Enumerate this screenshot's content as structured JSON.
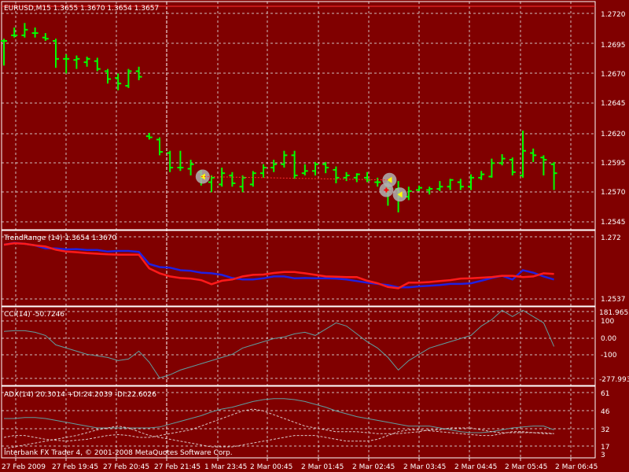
{
  "colors": {
    "background": "#800000",
    "grid": "#e0e0e0",
    "bar": "#00ff00",
    "trend_blue": "#2020e0",
    "trend_red": "#ff1a1a",
    "cci_line": "#5f9ea0",
    "adx_line": "#5f9ea0",
    "di_line": "#d8c8c8",
    "text": "#ffffff"
  },
  "main": {
    "title": "EURUSD,M15  1.3655 1.3670 1.3654 1.3657",
    "ticks": [
      "1.2720",
      "1.2695",
      "1.2670",
      "1.2645",
      "1.2620",
      "1.2595",
      "1.2570",
      "1.2545"
    ]
  },
  "trend": {
    "title": "TrendRange (14)  1.3654 1.3670",
    "ticks": [
      "1.272",
      "1.2537"
    ]
  },
  "cci": {
    "title": "CCI(14) -50.7246",
    "ticks": [
      "181.9652",
      "100",
      "0.00",
      "-100",
      "-277.993"
    ]
  },
  "adx": {
    "title": "ADX(14) 20.3014 +DI:24.2039 -DI:22.6026",
    "ticks": [
      "61",
      "46",
      "32",
      "17",
      "3"
    ]
  },
  "footer": {
    "copyright": "Interbank FX Trader 4, © 2001-2008 MetaQuotes Software Corp."
  },
  "time_axis": [
    "27 Feb 2009",
    "27 Feb 19:45",
    "27 Feb 20:45",
    "27 Feb 21:45",
    "1 Mar 23:45",
    "2 Mar 00:45",
    "2 Mar 01:45",
    "2 Mar 02:45",
    "2 Mar 03:45",
    "2 Mar 04:45",
    "2 Mar 05:45",
    "2 Mar 06:45"
  ],
  "chart_data": [
    {
      "type": "bar",
      "title": "EURUSD,M15  1.3655 1.3670 1.3654 1.3657",
      "ylim": [
        1.2533,
        1.2733
      ],
      "bars": [
        {
          "o": 1.27,
          "h": 1.2702,
          "l": 1.2678,
          "c": 1.27
        },
        {
          "o": 1.2705,
          "h": 1.2712,
          "l": 1.2703,
          "c": 1.2705
        },
        {
          "o": 1.2705,
          "h": 1.2716,
          "l": 1.2703,
          "c": 1.271
        },
        {
          "o": 1.2707,
          "h": 1.2712,
          "l": 1.2703,
          "c": 1.2707
        },
        {
          "o": 1.2703,
          "h": 1.2707,
          "l": 1.27,
          "c": 1.2702
        },
        {
          "o": 1.27,
          "h": 1.2702,
          "l": 1.2676,
          "c": 1.2684
        },
        {
          "o": 1.2684,
          "h": 1.2688,
          "l": 1.2671,
          "c": 1.2684
        },
        {
          "o": 1.2683,
          "h": 1.2687,
          "l": 1.2675,
          "c": 1.2684
        },
        {
          "o": 1.2681,
          "h": 1.2686,
          "l": 1.2677,
          "c": 1.2684
        },
        {
          "o": 1.2682,
          "h": 1.2685,
          "l": 1.2673,
          "c": 1.2675
        },
        {
          "o": 1.2673,
          "h": 1.2675,
          "l": 1.2662,
          "c": 1.2666
        },
        {
          "o": 1.2667,
          "h": 1.2671,
          "l": 1.2656,
          "c": 1.2662
        },
        {
          "o": 1.266,
          "h": 1.2675,
          "l": 1.2658,
          "c": 1.2673
        },
        {
          "o": 1.2673,
          "h": 1.2677,
          "l": 1.2665,
          "c": 1.2668
        },
        {
          "o": 1.2615,
          "h": 1.2618,
          "l": 1.2612,
          "c": 1.2614
        },
        {
          "o": 1.2612,
          "h": 1.2614,
          "l": 1.2598,
          "c": 1.2601
        },
        {
          "o": 1.26,
          "h": 1.2602,
          "l": 1.2583,
          "c": 1.2587
        },
        {
          "o": 1.2587,
          "h": 1.2602,
          "l": 1.2584,
          "c": 1.2587
        },
        {
          "o": 1.2586,
          "h": 1.2594,
          "l": 1.258,
          "c": 1.259
        },
        {
          "o": 1.2583,
          "h": 1.2585,
          "l": 1.2571,
          "c": 1.2578
        },
        {
          "o": 1.2574,
          "h": 1.258,
          "l": 1.2565,
          "c": 1.2578
        },
        {
          "o": 1.2572,
          "h": 1.2587,
          "l": 1.257,
          "c": 1.2582
        },
        {
          "o": 1.258,
          "h": 1.2583,
          "l": 1.257,
          "c": 1.2573
        },
        {
          "o": 1.257,
          "h": 1.258,
          "l": 1.2565,
          "c": 1.2578
        },
        {
          "o": 1.2572,
          "h": 1.2584,
          "l": 1.257,
          "c": 1.2582
        },
        {
          "o": 1.2582,
          "h": 1.259,
          "l": 1.2578,
          "c": 1.2587
        },
        {
          "o": 1.2587,
          "h": 1.2594,
          "l": 1.2583,
          "c": 1.259
        },
        {
          "o": 1.259,
          "h": 1.2602,
          "l": 1.2587,
          "c": 1.2598
        },
        {
          "o": 1.2598,
          "h": 1.2602,
          "l": 1.2577,
          "c": 1.258
        },
        {
          "o": 1.2582,
          "h": 1.259,
          "l": 1.258,
          "c": 1.2584
        },
        {
          "o": 1.2584,
          "h": 1.2592,
          "l": 1.258,
          "c": 1.259
        },
        {
          "o": 1.259,
          "h": 1.2592,
          "l": 1.2582,
          "c": 1.2587
        },
        {
          "o": 1.2585,
          "h": 1.2588,
          "l": 1.2573,
          "c": 1.2578
        },
        {
          "o": 1.2578,
          "h": 1.2583,
          "l": 1.2575,
          "c": 1.258
        },
        {
          "o": 1.2578,
          "h": 1.2582,
          "l": 1.2574,
          "c": 1.2581
        },
        {
          "o": 1.2578,
          "h": 1.2583,
          "l": 1.2574,
          "c": 1.2576
        },
        {
          "o": 1.2574,
          "h": 1.2578,
          "l": 1.257,
          "c": 1.2574
        },
        {
          "o": 1.2571,
          "h": 1.2576,
          "l": 1.2553,
          "c": 1.2568
        },
        {
          "o": 1.2568,
          "h": 1.2575,
          "l": 1.2547,
          "c": 1.2561
        },
        {
          "o": 1.2561,
          "h": 1.257,
          "l": 1.2558,
          "c": 1.2566
        },
        {
          "o": 1.2567,
          "h": 1.2571,
          "l": 1.2566,
          "c": 1.2569
        },
        {
          "o": 1.2567,
          "h": 1.257,
          "l": 1.2563,
          "c": 1.2568
        },
        {
          "o": 1.2568,
          "h": 1.2575,
          "l": 1.2566,
          "c": 1.257
        },
        {
          "o": 1.257,
          "h": 1.2577,
          "l": 1.2567,
          "c": 1.2576
        },
        {
          "o": 1.2574,
          "h": 1.2577,
          "l": 1.2567,
          "c": 1.257
        },
        {
          "o": 1.257,
          "h": 1.2581,
          "l": 1.2567,
          "c": 1.2578
        },
        {
          "o": 1.2578,
          "h": 1.2584,
          "l": 1.2576,
          "c": 1.2581
        },
        {
          "o": 1.2579,
          "h": 1.2595,
          "l": 1.2578,
          "c": 1.2591
        },
        {
          "o": 1.2591,
          "h": 1.2599,
          "l": 1.2589,
          "c": 1.2595
        },
        {
          "o": 1.2594,
          "h": 1.2596,
          "l": 1.258,
          "c": 1.2583
        },
        {
          "o": 1.258,
          "h": 1.262,
          "l": 1.2578,
          "c": 1.2602
        },
        {
          "o": 1.26,
          "h": 1.2604,
          "l": 1.2592,
          "c": 1.2598
        },
        {
          "o": 1.2596,
          "h": 1.2598,
          "l": 1.258,
          "c": 1.2594
        },
        {
          "o": 1.259,
          "h": 1.2592,
          "l": 1.2567,
          "c": 1.2582
        }
      ],
      "markers": [
        {
          "bar": 19,
          "price": 1.2579,
          "kind": "circle-arrow"
        },
        {
          "bar": 37,
          "price": 1.2576,
          "kind": "circle-arrow"
        },
        {
          "bar": 37,
          "price": 1.2567,
          "kind": "circle-cross"
        },
        {
          "bar": 38,
          "price": 1.2563,
          "kind": "circle-arrow"
        }
      ]
    },
    {
      "type": "line",
      "title": "TrendRange (14)  1.3654 1.3670",
      "ylim": [
        1.253,
        1.274
      ],
      "series": [
        {
          "color": "#2020e0",
          "values": [
            1.2712,
            1.2718,
            1.2715,
            1.271,
            1.27,
            1.27,
            1.2697,
            1.2698,
            1.2695,
            1.2695,
            1.269,
            1.2692,
            1.2692,
            1.2689,
            1.265,
            1.264,
            1.2638,
            1.263,
            1.2628,
            1.2622,
            1.262,
            1.2615,
            1.2605,
            1.26,
            1.26,
            1.2604,
            1.261,
            1.261,
            1.2604,
            1.2605,
            1.2604,
            1.2604,
            1.2603,
            1.26,
            1.2595,
            1.259,
            1.2586,
            1.2582,
            1.2575,
            1.2575,
            1.2578,
            1.258,
            1.2582,
            1.2586,
            1.2586,
            1.2588,
            1.2596,
            1.2605,
            1.2612,
            1.26,
            1.263,
            1.2622,
            1.261,
            1.26
          ]
        },
        {
          "color": "#ff1a1a",
          "values": [
            1.2712,
            1.2717,
            1.2715,
            1.271,
            1.2706,
            1.2696,
            1.269,
            1.2688,
            1.2685,
            1.2683,
            1.2681,
            1.268,
            1.268,
            1.268,
            1.2636,
            1.262,
            1.261,
            1.2605,
            1.2603,
            1.2598,
            1.2585,
            1.2596,
            1.26,
            1.261,
            1.2615,
            1.2616,
            1.2621,
            1.2624,
            1.2624,
            1.262,
            1.2615,
            1.261,
            1.2609,
            1.2608,
            1.2608,
            1.2596,
            1.2588,
            1.2576,
            1.2572,
            1.259,
            1.259,
            1.2592,
            1.2595,
            1.2598,
            1.2603,
            1.2604,
            1.2606,
            1.2608,
            1.2612,
            1.2612,
            1.2608,
            1.261,
            1.262,
            1.2618
          ]
        }
      ]
    },
    {
      "type": "line",
      "title": "CCI(14) -50.7246",
      "ylim": [
        -277.993,
        181.9652
      ],
      "series": [
        {
          "color": "#5f9ea0",
          "values": [
            46,
            50,
            50,
            40,
            20,
            -40,
            -60,
            -80,
            -100,
            -110,
            -120,
            -140,
            -130,
            -80,
            -150,
            -250,
            -230,
            -200,
            -180,
            -160,
            -140,
            -120,
            -100,
            -60,
            -40,
            -20,
            0,
            10,
            30,
            40,
            20,
            60,
            100,
            80,
            30,
            -20,
            -60,
            -120,
            -200,
            -140,
            -100,
            -60,
            -40,
            -20,
            0,
            20,
            80,
            120,
            180,
            140,
            180,
            140,
            100,
            -50
          ]
        }
      ]
    },
    {
      "type": "line",
      "title": "ADX(14) 20.3014 +DI:24.2039 -DI:22.6026",
      "ylim": [
        0,
        70
      ],
      "series": [
        {
          "color": "#5f9ea0",
          "values": [
            40,
            40,
            41,
            41,
            40,
            38,
            36,
            34,
            32,
            30,
            30,
            30,
            30,
            30,
            30,
            31,
            34,
            37,
            40,
            43,
            47,
            50,
            52,
            55,
            58,
            60,
            61,
            61,
            60,
            58,
            55,
            52,
            48,
            45,
            42,
            40,
            38,
            36,
            34,
            32,
            32,
            32,
            30,
            28,
            26,
            25,
            25,
            26,
            28,
            30,
            31,
            32,
            32,
            28
          ]
        },
        {
          "color": "#d8c8c8",
          "dashed": true,
          "values": [
            20,
            22,
            22,
            20,
            18,
            17,
            16,
            17,
            18,
            20,
            22,
            23,
            22,
            20,
            20,
            22,
            24,
            26,
            28,
            32,
            36,
            40,
            44,
            48,
            50,
            48,
            44,
            40,
            36,
            32,
            30,
            28,
            26,
            26,
            26,
            25,
            24,
            24,
            24,
            25,
            26,
            28,
            28,
            30,
            30,
            30,
            28,
            26,
            25,
            25,
            25,
            25,
            25,
            24
          ]
        },
        {
          "color": "#d8c8c8",
          "dashed": true,
          "values": [
            8,
            10,
            12,
            14,
            16,
            18,
            20,
            22,
            25,
            28,
            30,
            32,
            30,
            26,
            22,
            20,
            18,
            16,
            14,
            12,
            10,
            10,
            10,
            12,
            14,
            16,
            18,
            20,
            22,
            22,
            22,
            20,
            18,
            16,
            16,
            16,
            18,
            22,
            26,
            28,
            28,
            27,
            26,
            25,
            24,
            23,
            22,
            22,
            24,
            26,
            26,
            25,
            24,
            24
          ]
        }
      ]
    }
  ]
}
